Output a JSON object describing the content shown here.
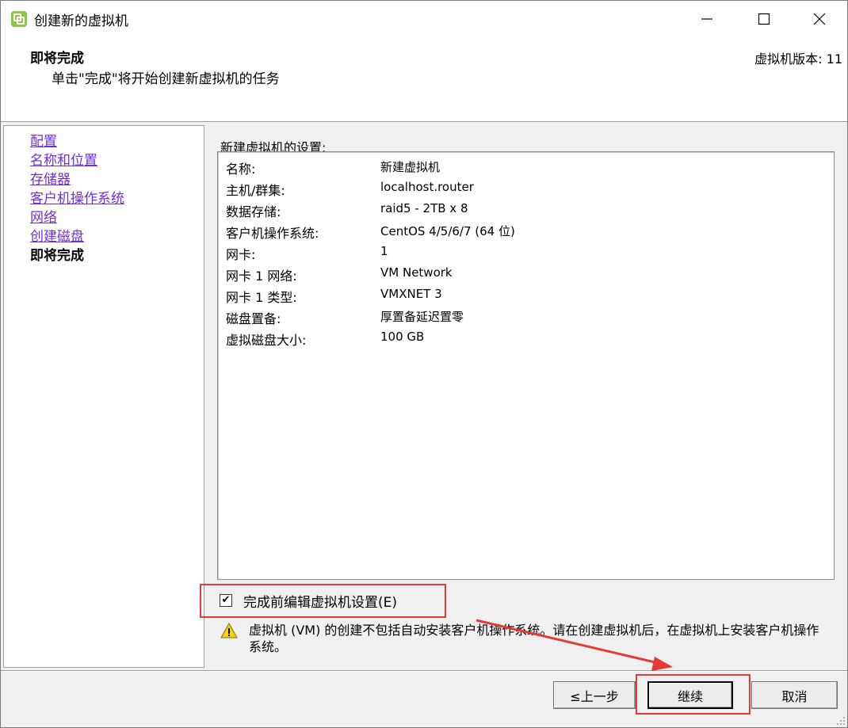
{
  "window": {
    "title": "创建新的虚拟机",
    "icons": [
      "vmware-app-icon",
      "minimize-icon",
      "maximize-icon",
      "close-icon"
    ]
  },
  "header": {
    "title": "即将完成",
    "subtitle": "单击\"完成\"将开始创建新虚拟机的任务",
    "version": "虚拟机版本: 11"
  },
  "sidebar": {
    "items": [
      {
        "label": "配置",
        "current": false
      },
      {
        "label": "名称和位置",
        "current": false
      },
      {
        "label": "存储器",
        "current": false
      },
      {
        "label": "客户机操作系统",
        "current": false
      },
      {
        "label": "网络",
        "current": false
      },
      {
        "label": "创建磁盘",
        "current": false
      },
      {
        "label": "即将完成",
        "current": true
      }
    ]
  },
  "settings": {
    "label": "新建虚拟机的设置:",
    "rows": [
      {
        "label": "名称:",
        "value": "新建虚拟机"
      },
      {
        "label": "主机/群集:",
        "value": "localhost.router"
      },
      {
        "label": "数据存储:",
        "value": "raid5 - 2TB x 8"
      },
      {
        "label": "客户机操作系统:",
        "value": "CentOS 4/5/6/7 (64 位)"
      },
      {
        "label": "网卡:",
        "value": "1"
      },
      {
        "label": "网卡 1 网络:",
        "value": "VM Network"
      },
      {
        "label": "网卡 1 类型:",
        "value": "VMXNET 3"
      },
      {
        "label": "磁盘置备:",
        "value": "厚置备延迟置零"
      },
      {
        "label": "虚拟磁盘大小:",
        "value": "100 GB"
      }
    ]
  },
  "edit_checkbox": {
    "label": "完成前编辑虚拟机设置(E)",
    "checked": true
  },
  "warning": {
    "icon": "warning-icon",
    "text": "虚拟机 (VM) 的创建不包括自动安装客户机操作系统。请在创建虚拟机后，在虚拟机上安装客户机操作系统。"
  },
  "buttons": {
    "back": "≤上一步",
    "next": "继续",
    "cancel": "取消"
  },
  "colors": {
    "link": "#6f2fd8",
    "annotation": "#e53935"
  }
}
